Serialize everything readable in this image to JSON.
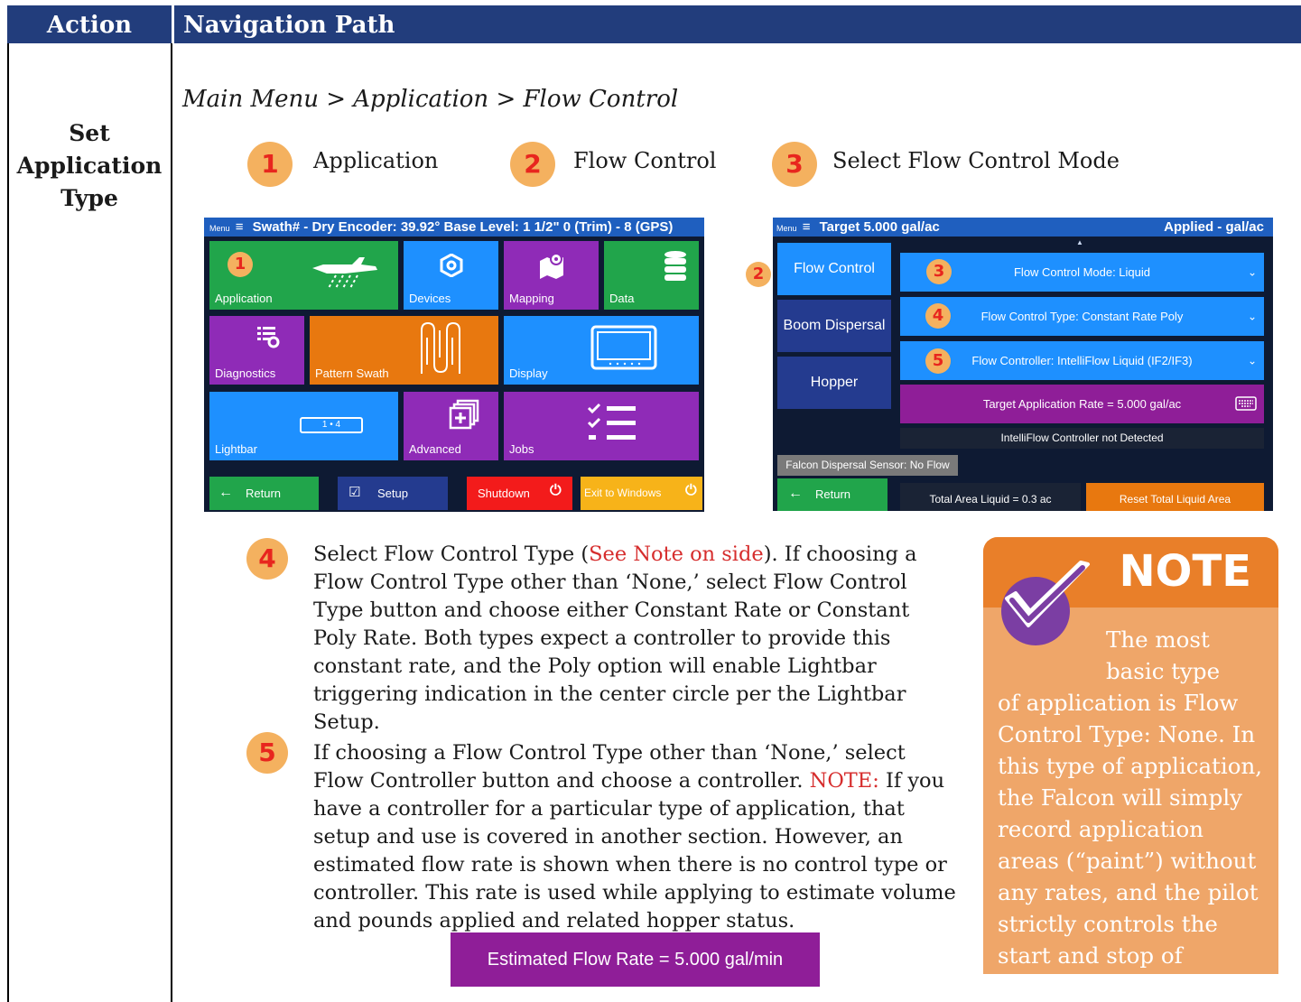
{
  "table": {
    "col_action": "Action",
    "col_nav": "Navigation Path",
    "row_action": "Set Application Type"
  },
  "path": "Main Menu > Application > Flow Control",
  "steps": [
    {
      "num": "1",
      "label": "Application"
    },
    {
      "num": "2",
      "label": "Flow Control"
    },
    {
      "num": "3",
      "label": "Select Flow Control Mode"
    },
    {
      "num": "4"
    },
    {
      "num": "5"
    }
  ],
  "screen1": {
    "bar": "Swath# -   Dry Encoder: 39.92°   Base Level: 1 1/2\"  0 (Trim) - 8 (GPS)",
    "menu": "Menu",
    "tiles": [
      "Application",
      "Devices",
      "Mapping",
      "Data",
      "Diagnostics",
      "Pattern Swath",
      "Display",
      "Lightbar",
      "Advanced",
      "Jobs"
    ],
    "lightbar_text": "1  •  4",
    "buttons": [
      "Return",
      "Setup",
      "Shutdown",
      "Exit to Windows"
    ]
  },
  "screen2": {
    "menu": "Menu",
    "bar_left": "Target 5.000 gal/ac",
    "bar_right": "Applied - gal/ac",
    "side": [
      "Flow Control",
      "Boom Dispersal",
      "Hopper"
    ],
    "mode": "Flow Control Mode: Liquid",
    "type": "Flow Control Type: Constant Rate Poly",
    "controller": "Flow Controller: IntelliFlow Liquid (IF2/IF3)",
    "target_rate": "Target Application Rate = 5.000 gal/ac",
    "not_detected": "IntelliFlow Controller not Detected",
    "sensor": "Falcon Dispersal Sensor: No Flow",
    "return": "Return",
    "total_area": "Total Area Liquid = 0.3 ac",
    "reset": "Reset Total Liquid Area"
  },
  "para4": {
    "a": "Select Flow Control Type (",
    "link": "See Note on side",
    "b": "). If choosing a Flow Control Type other than ‘None,’ select Flow Control Type button and choose either Constant Rate or Constant Poly Rate. Both types expect a controller to provide this constant rate, and the Poly option will enable Lightbar triggering indication in the center circle per the Lightbar Setup."
  },
  "para5": {
    "a": "If choosing a Flow Control Type other than ‘None,’ select Flow Controller button and choose a controller. ",
    "note": "NOTE:",
    "b": " If you have a controller for a particular type of application, that setup and use is covered in another section. However, an estimated flow rate is shown when there is no control type or controller. This rate is used while applying to estimate volume and pounds applied and related hopper status."
  },
  "estimated": "Estimated Flow Rate = 5.000 gal/min",
  "note": {
    "title": "NOTE",
    "line1": "The most",
    "line2": "basic type",
    "rest": "of application is Flow Control Type: None.  In this type of application, the Falcon will simply record application areas (“paint”) without any rates, and the pilot strictly controls the start and stop of application."
  },
  "colors": {
    "header": "#223d7c",
    "step_circle": "#f4b15f",
    "step_num": "#e8261e",
    "note_bg": "#efa669",
    "note_head": "#e97f29",
    "check": "#7b3ea3"
  },
  "icons": [
    "airplane-icon",
    "gear-icon",
    "map-icon",
    "database-icon",
    "diagnostics-icon",
    "pattern-icon",
    "monitor-icon",
    "lightbar-icon",
    "advanced-icon",
    "checklist-icon",
    "keyboard-icon",
    "checkmark-icon"
  ]
}
